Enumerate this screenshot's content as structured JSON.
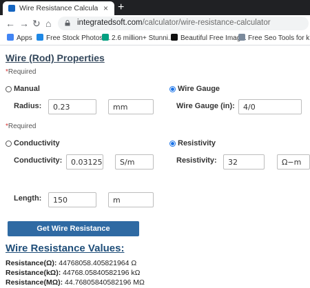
{
  "browser": {
    "tab_title": "Wire Resistance Calculator | INTE",
    "tab_close": "×",
    "new_tab": "+",
    "back": "←",
    "forward": "→",
    "reload": "↻",
    "home": "⌂",
    "url_host": "integratedsoft.com",
    "url_path": "/calculator/wire-resistance-calculator",
    "bookmarks": [
      {
        "label": "Apps",
        "icon": "apps-grid-icon",
        "color": "#4285f4"
      },
      {
        "label": "Free Stock Photos,...",
        "icon": "stock-photos-icon",
        "color": "#1e88e5"
      },
      {
        "label": "2.6 million+ Stunni...",
        "icon": "pexels-icon",
        "color": "#05a081"
      },
      {
        "label": "Beautiful Free Imag...",
        "icon": "unsplash-icon",
        "color": "#111111"
      },
      {
        "label": "Free Seo Tools for k...",
        "icon": "seo-tools-icon",
        "color": "#7b8a9c"
      }
    ]
  },
  "page": {
    "title": "Wire (Rod) Properties",
    "required_text": "Required",
    "required_mark": "*",
    "section1": {
      "option_manual": "Manual",
      "option_gauge": "Wire Gauge",
      "selected": "Wire Gauge",
      "radius_label": "Radius:",
      "radius_value": "0.23",
      "radius_unit": "mm",
      "gauge_label": "Wire Gauge (in):",
      "gauge_value": "4/0"
    },
    "section2": {
      "option_conductivity": "Conductivity",
      "option_resistivity": "Resistivity",
      "selected": "Resistivity",
      "conductivity_label": "Conductivity:",
      "conductivity_value": "0.03125",
      "conductivity_unit": "S/m",
      "resistivity_label": "Resistivity:",
      "resistivity_value": "32",
      "resistivity_unit": "Ω−m"
    },
    "length_label": "Length:",
    "length_value": "150",
    "length_unit": "m",
    "button_label": "Get Wire Resistance",
    "results_heading": "Wire Resistance Values:",
    "results": [
      {
        "label": "Resistance(Ω):",
        "value": "44768058.405821964 Ω"
      },
      {
        "label": "Resistance(kΩ):",
        "value": "44768.05840582196 kΩ"
      },
      {
        "label": "Resistance(MΩ):",
        "value": "44.76805840582196 MΩ"
      }
    ]
  },
  "colors": {
    "accent": "#1a73e8",
    "button": "#2f6aa3",
    "heading": "#33475b"
  }
}
